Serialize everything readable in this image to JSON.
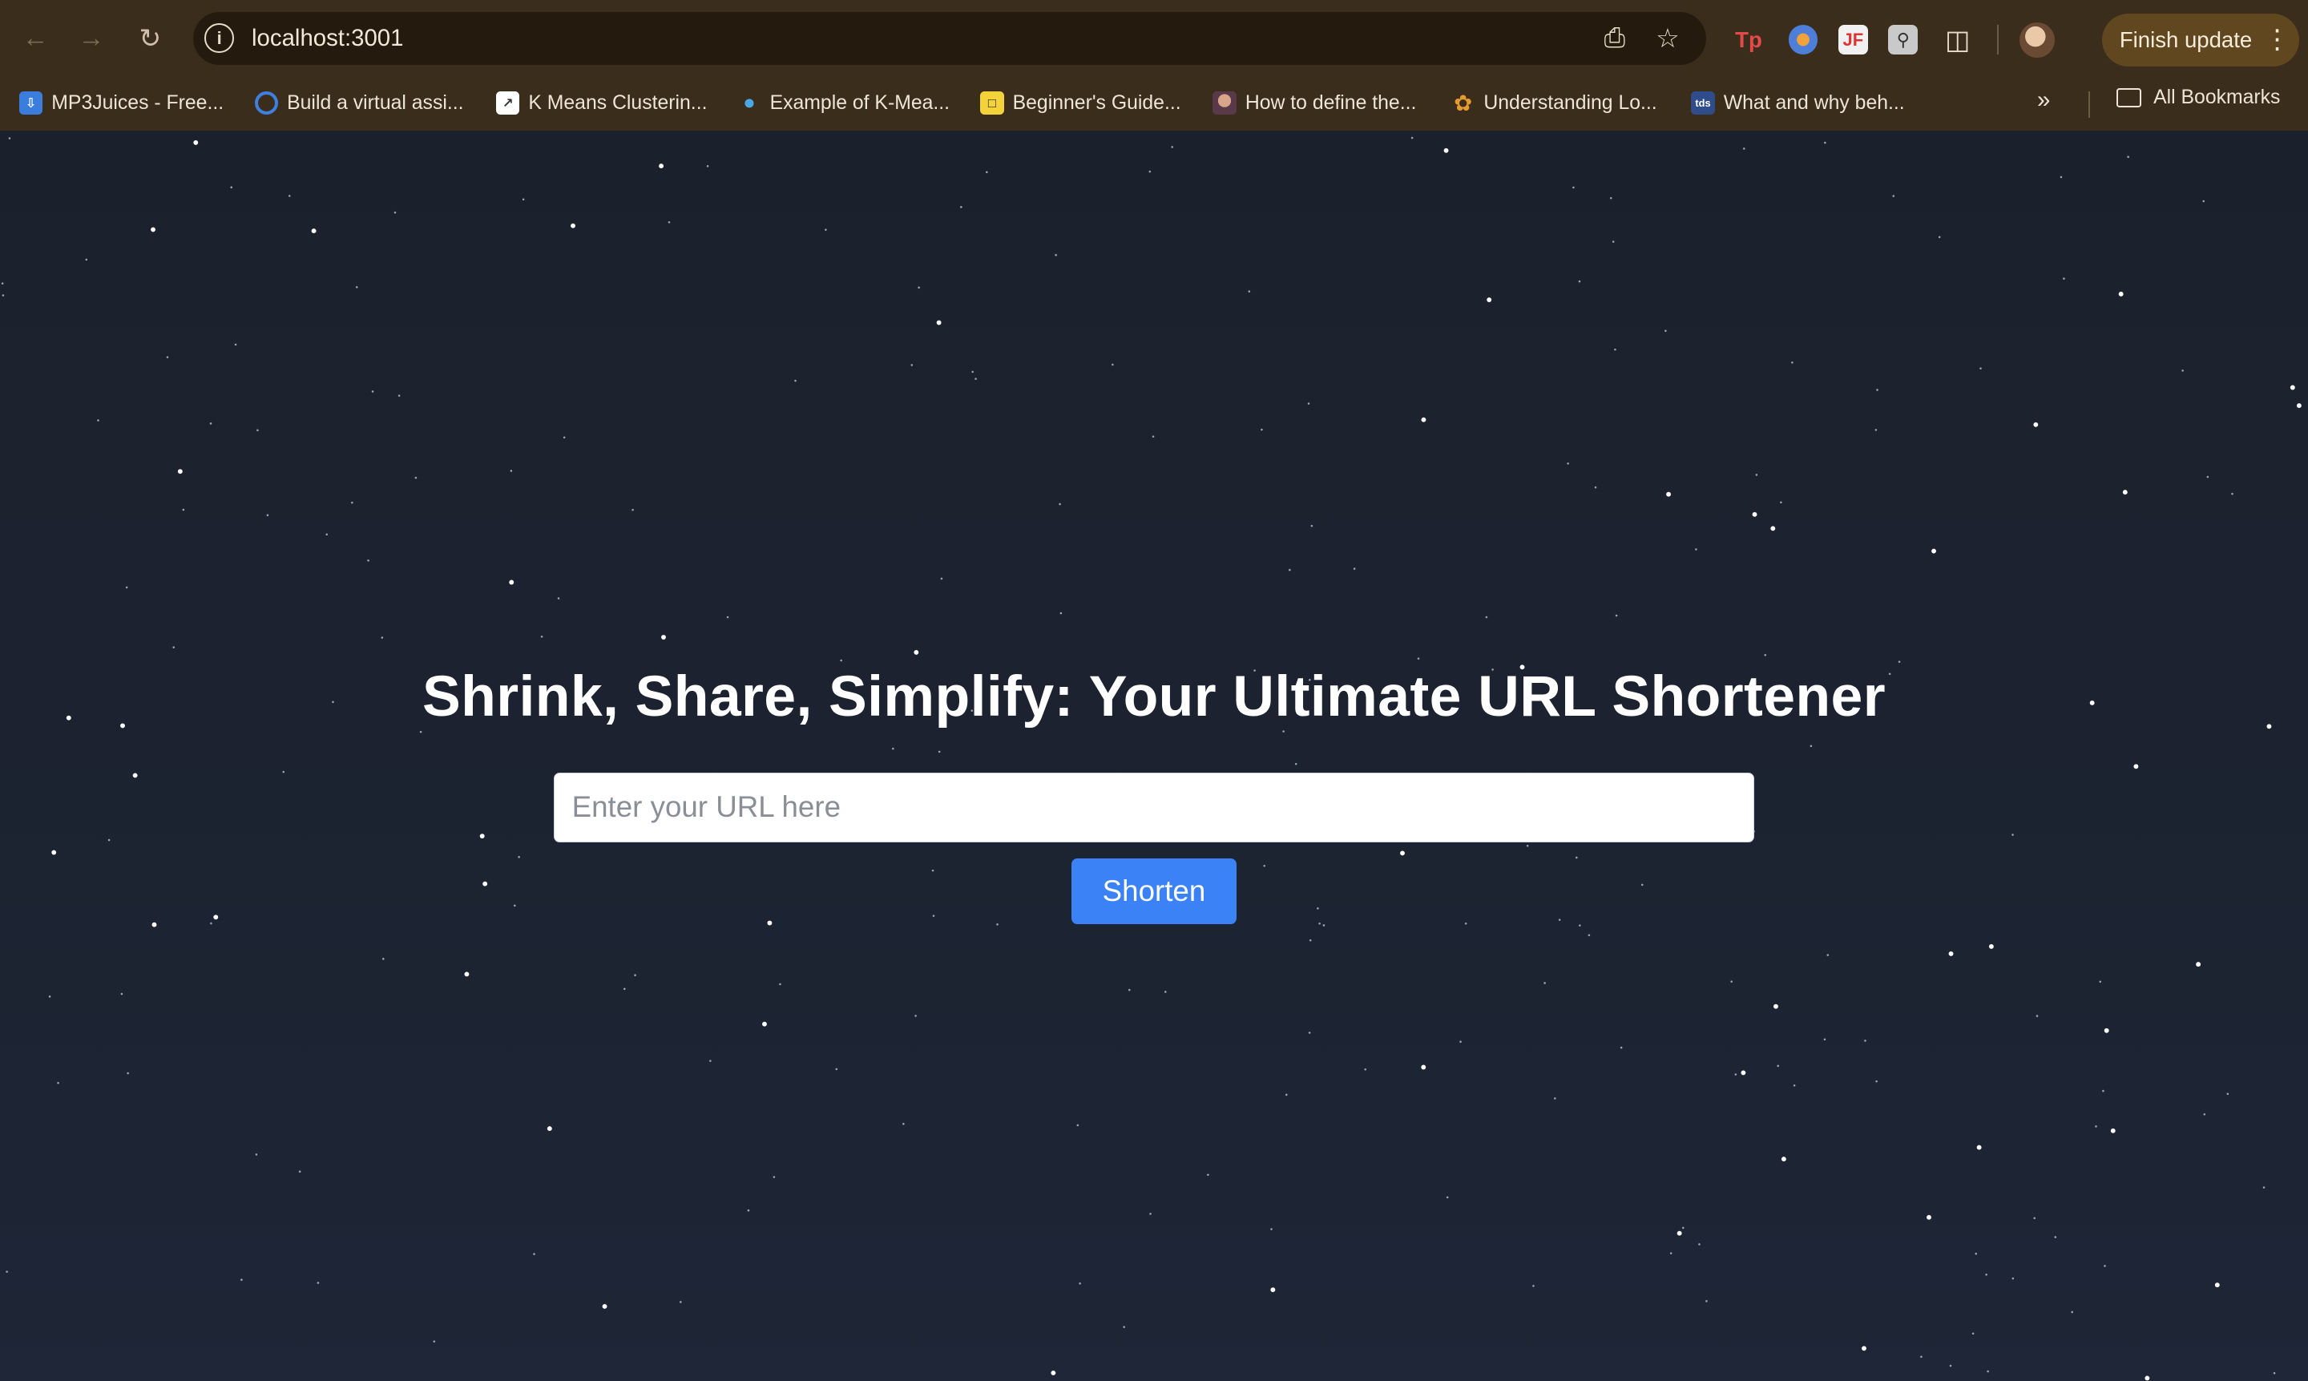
{
  "browser": {
    "url": "localhost:3001",
    "finish_update_label": "Finish update",
    "bookmarks": [
      {
        "label": "MP3Juices - Free...",
        "icon": "download-icon"
      },
      {
        "label": "Build a virtual assi...",
        "icon": "swirl-icon"
      },
      {
        "label": "K Means Clusterin...",
        "icon": "chart-icon"
      },
      {
        "label": "Example of K-Mea...",
        "icon": "fish-icon"
      },
      {
        "label": "Beginner's Guide...",
        "icon": "square-icon"
      },
      {
        "label": "How to define the...",
        "icon": "avatar-icon"
      },
      {
        "label": "Understanding Lo...",
        "icon": "flower-icon"
      },
      {
        "label": "What and why beh...",
        "icon": "tds-icon"
      }
    ],
    "all_bookmarks_label": "All Bookmarks"
  },
  "page": {
    "headline": "Shrink, Share, Simplify: Your Ultimate URL Shortener",
    "url_input_placeholder": "Enter your URL here",
    "shorten_button_label": "Shorten"
  },
  "colors": {
    "accent_button": "#3b82f6",
    "page_background": "#1b2230",
    "browser_chrome": "#3a2d1c"
  }
}
